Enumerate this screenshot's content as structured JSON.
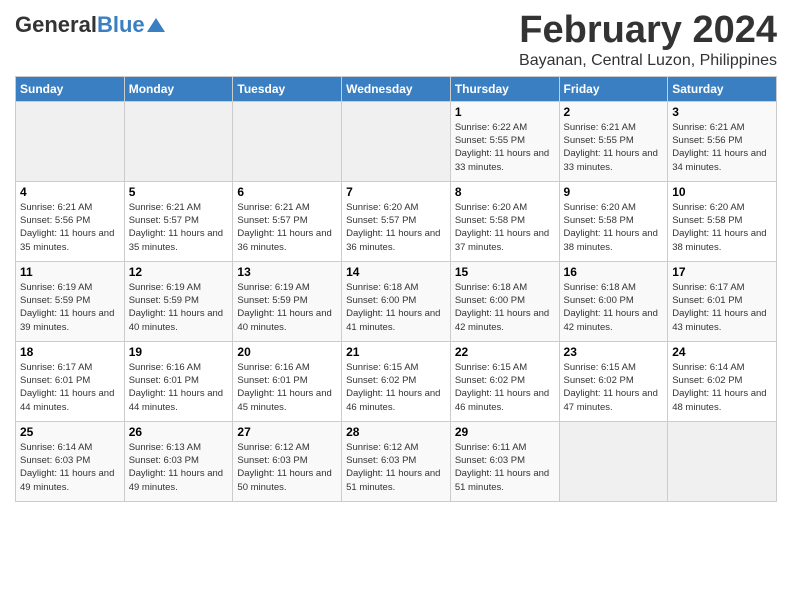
{
  "header": {
    "logo_general": "General",
    "logo_blue": "Blue",
    "month": "February 2024",
    "location": "Bayanan, Central Luzon, Philippines"
  },
  "calendar": {
    "days_of_week": [
      "Sunday",
      "Monday",
      "Tuesday",
      "Wednesday",
      "Thursday",
      "Friday",
      "Saturday"
    ],
    "weeks": [
      [
        {
          "day": "",
          "info": ""
        },
        {
          "day": "",
          "info": ""
        },
        {
          "day": "",
          "info": ""
        },
        {
          "day": "",
          "info": ""
        },
        {
          "day": "1",
          "info": "Sunrise: 6:22 AM\nSunset: 5:55 PM\nDaylight: 11 hours and 33 minutes."
        },
        {
          "day": "2",
          "info": "Sunrise: 6:21 AM\nSunset: 5:55 PM\nDaylight: 11 hours and 33 minutes."
        },
        {
          "day": "3",
          "info": "Sunrise: 6:21 AM\nSunset: 5:56 PM\nDaylight: 11 hours and 34 minutes."
        }
      ],
      [
        {
          "day": "4",
          "info": "Sunrise: 6:21 AM\nSunset: 5:56 PM\nDaylight: 11 hours and 35 minutes."
        },
        {
          "day": "5",
          "info": "Sunrise: 6:21 AM\nSunset: 5:57 PM\nDaylight: 11 hours and 35 minutes."
        },
        {
          "day": "6",
          "info": "Sunrise: 6:21 AM\nSunset: 5:57 PM\nDaylight: 11 hours and 36 minutes."
        },
        {
          "day": "7",
          "info": "Sunrise: 6:20 AM\nSunset: 5:57 PM\nDaylight: 11 hours and 36 minutes."
        },
        {
          "day": "8",
          "info": "Sunrise: 6:20 AM\nSunset: 5:58 PM\nDaylight: 11 hours and 37 minutes."
        },
        {
          "day": "9",
          "info": "Sunrise: 6:20 AM\nSunset: 5:58 PM\nDaylight: 11 hours and 38 minutes."
        },
        {
          "day": "10",
          "info": "Sunrise: 6:20 AM\nSunset: 5:58 PM\nDaylight: 11 hours and 38 minutes."
        }
      ],
      [
        {
          "day": "11",
          "info": "Sunrise: 6:19 AM\nSunset: 5:59 PM\nDaylight: 11 hours and 39 minutes."
        },
        {
          "day": "12",
          "info": "Sunrise: 6:19 AM\nSunset: 5:59 PM\nDaylight: 11 hours and 40 minutes."
        },
        {
          "day": "13",
          "info": "Sunrise: 6:19 AM\nSunset: 5:59 PM\nDaylight: 11 hours and 40 minutes."
        },
        {
          "day": "14",
          "info": "Sunrise: 6:18 AM\nSunset: 6:00 PM\nDaylight: 11 hours and 41 minutes."
        },
        {
          "day": "15",
          "info": "Sunrise: 6:18 AM\nSunset: 6:00 PM\nDaylight: 11 hours and 42 minutes."
        },
        {
          "day": "16",
          "info": "Sunrise: 6:18 AM\nSunset: 6:00 PM\nDaylight: 11 hours and 42 minutes."
        },
        {
          "day": "17",
          "info": "Sunrise: 6:17 AM\nSunset: 6:01 PM\nDaylight: 11 hours and 43 minutes."
        }
      ],
      [
        {
          "day": "18",
          "info": "Sunrise: 6:17 AM\nSunset: 6:01 PM\nDaylight: 11 hours and 44 minutes."
        },
        {
          "day": "19",
          "info": "Sunrise: 6:16 AM\nSunset: 6:01 PM\nDaylight: 11 hours and 44 minutes."
        },
        {
          "day": "20",
          "info": "Sunrise: 6:16 AM\nSunset: 6:01 PM\nDaylight: 11 hours and 45 minutes."
        },
        {
          "day": "21",
          "info": "Sunrise: 6:15 AM\nSunset: 6:02 PM\nDaylight: 11 hours and 46 minutes."
        },
        {
          "day": "22",
          "info": "Sunrise: 6:15 AM\nSunset: 6:02 PM\nDaylight: 11 hours and 46 minutes."
        },
        {
          "day": "23",
          "info": "Sunrise: 6:15 AM\nSunset: 6:02 PM\nDaylight: 11 hours and 47 minutes."
        },
        {
          "day": "24",
          "info": "Sunrise: 6:14 AM\nSunset: 6:02 PM\nDaylight: 11 hours and 48 minutes."
        }
      ],
      [
        {
          "day": "25",
          "info": "Sunrise: 6:14 AM\nSunset: 6:03 PM\nDaylight: 11 hours and 49 minutes."
        },
        {
          "day": "26",
          "info": "Sunrise: 6:13 AM\nSunset: 6:03 PM\nDaylight: 11 hours and 49 minutes."
        },
        {
          "day": "27",
          "info": "Sunrise: 6:12 AM\nSunset: 6:03 PM\nDaylight: 11 hours and 50 minutes."
        },
        {
          "day": "28",
          "info": "Sunrise: 6:12 AM\nSunset: 6:03 PM\nDaylight: 11 hours and 51 minutes."
        },
        {
          "day": "29",
          "info": "Sunrise: 6:11 AM\nSunset: 6:03 PM\nDaylight: 11 hours and 51 minutes."
        },
        {
          "day": "",
          "info": ""
        },
        {
          "day": "",
          "info": ""
        }
      ]
    ]
  }
}
